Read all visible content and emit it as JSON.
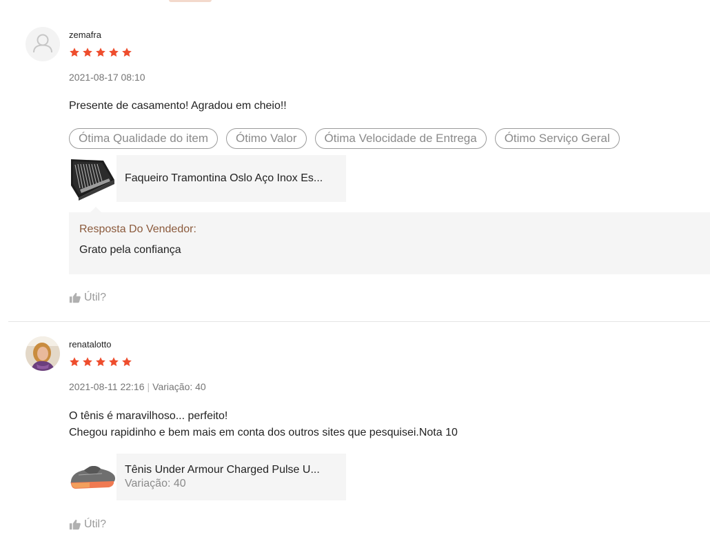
{
  "reviews": [
    {
      "username": "zemafra",
      "rating": 5,
      "date": "2021-08-17 08:10",
      "variation": "",
      "comment_lines": [
        "Presente de casamento! Agradou em cheio!!"
      ],
      "tags": [
        "Ótima Qualidade do item",
        "Ótimo Valor",
        "Ótima Velocidade de Entrega",
        "Ótimo Serviço Geral"
      ],
      "product": {
        "name": "Faqueiro Tramontina Oslo Aço Inox Es...",
        "variation": "",
        "image": "cutlery-set-thumbnail"
      },
      "seller_reply": {
        "title": "Resposta Do Vendedor:",
        "text": "Grato pela confiança"
      },
      "helpful_label": "Útil?"
    },
    {
      "username": "renatalotto",
      "rating": 5,
      "date": "2021-08-11 22:16",
      "variation": "Variação: 40",
      "separator": "|",
      "comment_lines": [
        "O tênis é maravilhoso... perfeito!",
        "Chegou rapidinho e bem mais em conta dos outros sites que pesquisei.Nota 10"
      ],
      "product": {
        "name": "Tênis Under Armour Charged Pulse U...",
        "variation": "Variação: 40",
        "image": "sneaker-thumbnail"
      },
      "helpful_label": "Útil?"
    }
  ],
  "colors": {
    "star": "#ee4d2d",
    "reply_title": "#8b5a3c",
    "muted": "#757575",
    "panel": "#f5f5f5"
  },
  "icons": {
    "star": "star-icon",
    "helpful": "thumbs-up-icon",
    "default_avatar": "user-silhouette-icon"
  }
}
